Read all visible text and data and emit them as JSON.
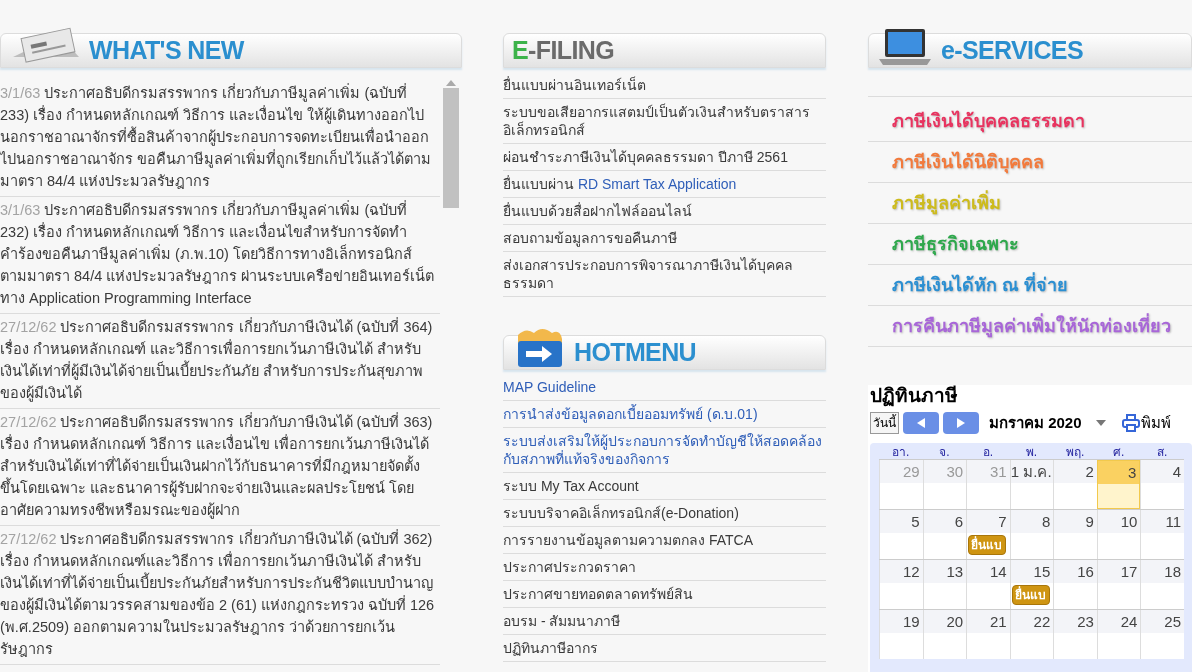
{
  "whats_new": {
    "title": "WHAT'S NEW",
    "items": [
      {
        "date": "3/1/63",
        "text": "ประกาศอธิบดีกรมสรรพากร เกี่ยวกับภาษีมูลค่าเพิ่ม (ฉบับที่ 233) เรื่อง กำหนดหลักเกณฑ์ วิธีการ และเงื่อนไข ให้ผู้เดินทางออกไปนอกราชอาณาจักรที่ซื้อสินค้าจากผู้ประกอบการจดทะเบียนเพื่อนำออกไปนอกราชอาณาจักร ขอคืนภาษีมูลค่าเพิ่มที่ถูกเรียกเก็บไว้แล้วได้ตามมาตรา 84/4 แห่งประมวลรัษฎากร"
      },
      {
        "date": "3/1/63",
        "text": "ประกาศอธิบดีกรมสรรพากร เกี่ยวกับภาษีมูลค่าเพิ่ม (ฉบับที่ 232) เรื่อง กำหนดหลักเกณฑ์ วิธีการ และเงื่อนไขสำหรับการจัดทำคำร้องขอคืนภาษีมูลค่าเพิ่ม (ภ.พ.10) โดยวิธีการทางอิเล็กทรอนิกส์ตามมาตรา 84/4 แห่งประมวลรัษฎากร ผ่านระบบเครือข่ายอินเทอร์เน็ตทาง Application Programming Interface"
      },
      {
        "date": "27/12/62",
        "text": "ประกาศอธิบดีกรมสรรพากร เกี่ยวกับภาษีเงินได้ (ฉบับที่ 364) เรื่อง กำหนดหลักเกณฑ์ และวิธีการเพื่อการยกเว้นภาษีเงินได้ สำหรับเงินได้เท่าที่ผู้มีเงินได้จ่ายเป็นเบี้ยประกันภัย สำหรับการประกันสุขภาพของผู้มีเงินได้"
      },
      {
        "date": "27/12/62",
        "text": "ประกาศอธิบดีกรมสรรพากร เกี่ยวกับภาษีเงินได้ (ฉบับที่ 363) เรื่อง กำหนดหลักเกณฑ์ วิธีการ และเงื่อนไข เพื่อการยกเว้นภาษีเงินได้ สำหรับเงินได้เท่าที่ได้จ่ายเป็นเงินฝากไว้กับธนาคารที่มีกฎหมายจัดตั้งขึ้นโดยเฉพาะ และธนาคารผู้รับฝากจะจ่ายเงินและผลประโยชน์ โดยอาศัยความทรงชีพหรือมรณะของผู้ฝาก"
      },
      {
        "date": "27/12/62",
        "text": "ประกาศอธิบดีกรมสรรพากร เกี่ยวกับภาษีเงินได้ (ฉบับที่ 362) เรื่อง กำหนดหลักเกณฑ์และวิธีการ เพื่อการยกเว้นภาษีเงินได้ สำหรับเงินได้เท่าที่ได้จ่ายเป็นเบี้ยประกันภัยสำหรับการประกันชีวิตแบบบำนาญของผู้มีเงินได้ตามวรรคสามของข้อ 2 (61) แห่งกฎกระทรวง ฉบับที่ 126 (พ.ศ.2509) ออกตามความในประมวลรัษฎากร ว่าด้วยการยกเว้นรัษฎากร"
      }
    ]
  },
  "efiling": {
    "title": "E-FILING",
    "items": [
      {
        "text": "ยื่นแบบผ่านอินเทอร์เน็ต"
      },
      {
        "text": "ระบบขอเสียอากรแสตมป์เป็นตัวเงินสำหรับตราสารอิเล็กทรอนิกส์"
      },
      {
        "text": "ผ่อนชำระภาษีเงินได้บุคคลธรรมดา ปีภาษี 2561"
      },
      {
        "text": "ยื่นแบบผ่าน",
        "link": "RD Smart Tax Application"
      },
      {
        "text": "ยื่นแบบด้วยสื่อฝากไฟล์ออนไลน์"
      },
      {
        "text": "สอบถามข้อมูลการขอคืนภาษี"
      },
      {
        "text": "ส่งเอกสารประกอบการพิจารณาภาษีเงินได้บุคคลธรรมดา"
      }
    ]
  },
  "hotmenu": {
    "title": "HOTMENU",
    "items": [
      {
        "kind": "link",
        "text": "MAP Guideline"
      },
      {
        "kind": "link",
        "text": "การนำส่งข้อมูลดอกเบี้ยออมทรัพย์ (ด.บ.01)"
      },
      {
        "kind": "link",
        "text": "ระบบส่งเสริมให้ผู้ประกอบการจัดทำบัญชีให้สอดคล้องกับสภาพที่แท้จริงของกิจการ"
      },
      {
        "kind": "plain",
        "text": "ระบบ My Tax Account"
      },
      {
        "kind": "plain",
        "text": "ระบบบริจาคอิเล็กทรอนิกส์(e-Donation)"
      },
      {
        "kind": "plain",
        "text": "การรายงานข้อมูลตามความตกลง FATCA"
      },
      {
        "kind": "plain",
        "text": "ประกาศประกวดราคา"
      },
      {
        "kind": "plain",
        "text": "ประกาศขายทอดตลาดทรัพย์สิน"
      },
      {
        "kind": "plain",
        "text": "อบรม - สัมมนาภาษี"
      },
      {
        "kind": "plain",
        "text": "ปฏิทินภาษีอากร"
      }
    ]
  },
  "eservices": {
    "title": "e-SERVICES",
    "items": [
      {
        "text": "ภาษีเงินได้บุคคลธรรมดา",
        "color": "#e8335f"
      },
      {
        "text": "ภาษีเงินได้นิติบุคคล",
        "color": "#f27a3c"
      },
      {
        "text": "ภาษีมูลค่าเพิ่ม",
        "color": "#cdbb1c"
      },
      {
        "text": "ภาษีธุรกิจเฉพาะ",
        "color": "#2ea84c"
      },
      {
        "text": "ภาษีเงินได้หัก ณ ที่จ่าย",
        "color": "#2b8fd2"
      },
      {
        "text": "การคืนภาษีมูลค่าเพิ่มให้นักท่องเที่ยว",
        "color": "#a866d8"
      }
    ]
  },
  "calendar": {
    "title": "ปฏิทินภาษี",
    "today_button": "วันนี้",
    "month": "มกราคม 2020",
    "print": "พิมพ์",
    "weekdays": [
      "อา.",
      "จ.",
      "อ.",
      "พ.",
      "พฤ.",
      "ศ.",
      "ส."
    ],
    "weeks": [
      [
        {
          "label": "29",
          "muted": true,
          "today": false
        },
        {
          "label": "30",
          "muted": true,
          "today": false
        },
        {
          "label": "31",
          "muted": true,
          "today": false
        },
        {
          "label": "1 ม.ค.",
          "muted": false,
          "today": false
        },
        {
          "label": "2",
          "muted": false,
          "today": false
        },
        {
          "label": "3",
          "muted": false,
          "today": true
        },
        {
          "label": "4",
          "muted": false,
          "today": false
        }
      ],
      [
        {
          "label": "5",
          "muted": false,
          "today": false
        },
        {
          "label": "6",
          "muted": false,
          "today": false
        },
        {
          "label": "7",
          "muted": false,
          "today": false,
          "event": "ยื่นแบ"
        },
        {
          "label": "8",
          "muted": false,
          "today": false
        },
        {
          "label": "9",
          "muted": false,
          "today": false
        },
        {
          "label": "10",
          "muted": false,
          "today": false
        },
        {
          "label": "11",
          "muted": false,
          "today": false
        }
      ],
      [
        {
          "label": "12",
          "muted": false,
          "today": false
        },
        {
          "label": "13",
          "muted": false,
          "today": false
        },
        {
          "label": "14",
          "muted": false,
          "today": false
        },
        {
          "label": "15",
          "muted": false,
          "today": false,
          "event": "ยื่นแบ"
        },
        {
          "label": "16",
          "muted": false,
          "today": false
        },
        {
          "label": "17",
          "muted": false,
          "today": false
        },
        {
          "label": "18",
          "muted": false,
          "today": false
        }
      ],
      [
        {
          "label": "19",
          "muted": false,
          "today": false
        },
        {
          "label": "20",
          "muted": false,
          "today": false
        },
        {
          "label": "21",
          "muted": false,
          "today": false
        },
        {
          "label": "22",
          "muted": false,
          "today": false
        },
        {
          "label": "23",
          "muted": false,
          "today": false
        },
        {
          "label": "24",
          "muted": false,
          "today": false
        },
        {
          "label": "25",
          "muted": false,
          "today": false
        }
      ]
    ]
  }
}
